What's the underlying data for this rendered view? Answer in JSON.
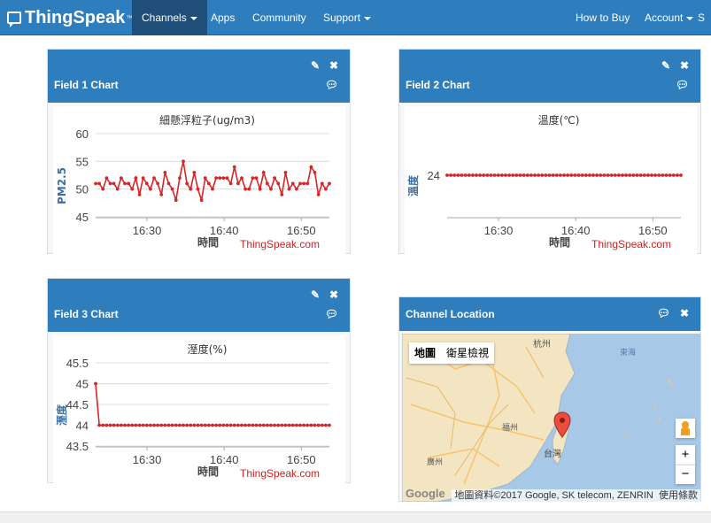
{
  "nav": {
    "logo": "ThingSpeak",
    "tm": "™",
    "items": [
      {
        "label": "Channels",
        "dropdown": true,
        "active": true
      },
      {
        "label": "Apps"
      },
      {
        "label": "Community"
      },
      {
        "label": "Support",
        "dropdown": true
      },
      {
        "label": "How to Buy"
      },
      {
        "label": "Account",
        "dropdown": true
      },
      {
        "label": "S"
      }
    ]
  },
  "panels": {
    "field1": {
      "title": "Field 1 Chart",
      "credit": "ThingSpeak.com"
    },
    "field2": {
      "title": "Field 2 Chart",
      "credit": "ThingSpeak.com"
    },
    "field3": {
      "title": "Field 3 Chart",
      "credit": "ThingSpeak.com"
    },
    "location": {
      "title": "Channel Location"
    }
  },
  "icons": {
    "edit": "pencil-icon",
    "close": "close-icon",
    "comment": "comment-icon"
  },
  "colors": {
    "header": "#2e7dbc",
    "nav_active": "#1f4f78",
    "series": "#d62728",
    "credit": "#cc2222"
  },
  "map": {
    "tabs": [
      "地圖",
      "衛星檢視"
    ],
    "selected_tab": "地圖",
    "copyright": "地圖資料©2017 Google, SK telecom, ZENRIN",
    "terms": "使用條款",
    "google": "Google",
    "zoom_in": "+",
    "zoom_out": "−",
    "labels": [
      "杭州",
      "東海",
      "台灣",
      "福州",
      "廣州"
    ]
  },
  "chart_data": [
    {
      "type": "line",
      "title": "細懸浮粒子(ug/m3)",
      "xlabel": "時間",
      "ylabel": "PM2.5",
      "x_ticks": [
        "16:30",
        "16:40",
        "16:50"
      ],
      "y_ticks": [
        45,
        50,
        55,
        60
      ],
      "ylim": [
        45,
        60
      ],
      "grid": true,
      "series": [
        {
          "values": [
            51,
            51,
            50,
            52,
            51,
            51,
            50,
            52,
            51,
            51,
            50,
            52,
            49,
            52,
            51,
            50,
            52,
            51,
            49,
            53,
            51,
            50,
            48,
            52,
            55,
            51,
            50,
            53,
            50,
            48,
            52,
            51,
            50,
            52,
            52,
            52,
            52,
            51,
            54,
            51,
            52,
            50,
            50,
            52,
            52,
            50,
            53,
            51,
            50,
            52,
            51,
            49,
            53,
            50,
            51,
            50,
            51,
            51,
            51,
            54,
            53,
            49,
            51,
            50,
            51
          ]
        }
      ]
    },
    {
      "type": "line",
      "title": "溫度(℃)",
      "xlabel": "時間",
      "ylabel": "溫度",
      "x_ticks": [
        "16:30",
        "16:40",
        "16:50"
      ],
      "y_ticks": [
        24
      ],
      "ylim": [
        23.6,
        24.4
      ],
      "grid": true,
      "series": [
        {
          "values": [
            24,
            24,
            24,
            24,
            24,
            24,
            24,
            24,
            24,
            24,
            24,
            24,
            24,
            24,
            24,
            24,
            24,
            24,
            24,
            24,
            24,
            24,
            24,
            24,
            24,
            24,
            24,
            24,
            24,
            24,
            24,
            24,
            24,
            24,
            24,
            24,
            24,
            24,
            24,
            24,
            24,
            24,
            24,
            24,
            24,
            24,
            24,
            24,
            24,
            24,
            24,
            24,
            24,
            24,
            24,
            24,
            24,
            24,
            24,
            24,
            24,
            24,
            24,
            24,
            24
          ]
        }
      ]
    },
    {
      "type": "line",
      "title": "溼度(%)",
      "xlabel": "時間",
      "ylabel": "溼度",
      "x_ticks": [
        "16:30",
        "16:40",
        "16:50"
      ],
      "y_ticks": [
        43.5,
        44,
        44.5,
        45,
        45.5
      ],
      "ylim": [
        43.5,
        45.5
      ],
      "grid": true,
      "series": [
        {
          "values": [
            45,
            44,
            44,
            44,
            44,
            44,
            44,
            44,
            44,
            44,
            44,
            44,
            44,
            44,
            44,
            44,
            44,
            44,
            44,
            44,
            44,
            44,
            44,
            44,
            44,
            44,
            44,
            44,
            44,
            44,
            44,
            44,
            44,
            44,
            44,
            44,
            44,
            44,
            44,
            44,
            44,
            44,
            44,
            44,
            44,
            44,
            44,
            44,
            44,
            44,
            44,
            44,
            44,
            44,
            44,
            44,
            44,
            44,
            44,
            44,
            44,
            44,
            44,
            44,
            44
          ]
        }
      ]
    }
  ]
}
